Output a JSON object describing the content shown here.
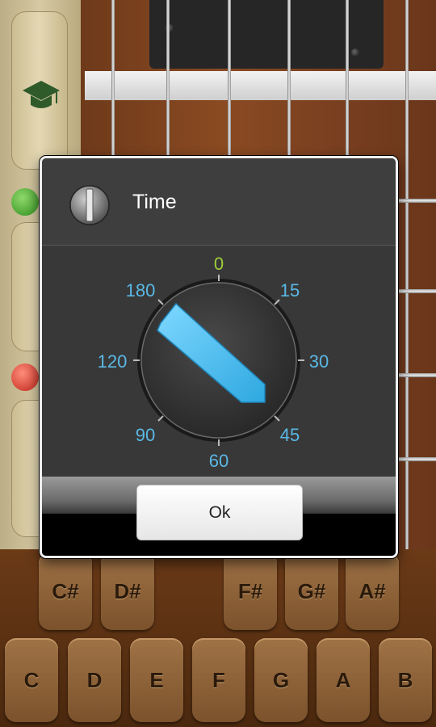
{
  "dialog": {
    "title": "Time",
    "icon": "timer-knob-icon",
    "ok_label": "Ok"
  },
  "dial": {
    "tick_labels": [
      "0",
      "15",
      "30",
      "45",
      "60",
      "90",
      "120",
      "180"
    ],
    "selected_label": "0",
    "colors": {
      "labels": "#5ab8e6",
      "selected": "#9fce3a",
      "pointer": "#4fc3f2"
    }
  },
  "keyboard": {
    "sharp_keys": [
      "C#",
      "D#",
      "F#",
      "G#",
      "A#"
    ],
    "natural_keys": [
      "C",
      "D",
      "E",
      "F",
      "G",
      "A",
      "B"
    ]
  },
  "sidebar": {
    "icons": [
      "graduation-cap-icon",
      "check-icon",
      "close-icon"
    ]
  }
}
